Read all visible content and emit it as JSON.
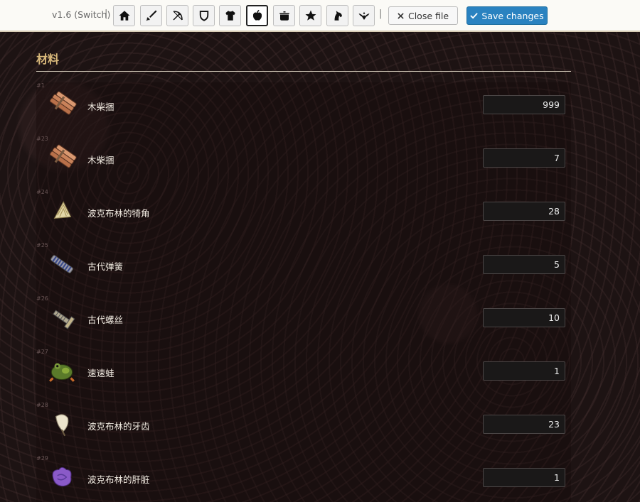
{
  "toolbar": {
    "version": "v1.6 (Switch)",
    "separator": "|",
    "category_buttons": [
      {
        "icon": "home-icon"
      },
      {
        "icon": "sword-icon"
      },
      {
        "icon": "bow-icon"
      },
      {
        "icon": "shield-icon"
      },
      {
        "icon": "armor-icon"
      },
      {
        "icon": "apple-icon",
        "active": true
      },
      {
        "icon": "cooking-pot-icon"
      },
      {
        "icon": "star-icon"
      },
      {
        "icon": "horse-icon"
      },
      {
        "icon": "hylian-crest-icon"
      }
    ],
    "close_label": "Close file",
    "save_label": "Save changes",
    "accent_color": "#2a82c0"
  },
  "section": {
    "title": "材料",
    "title_color": "#d8b87a"
  },
  "items": [
    {
      "num": "#1",
      "name": "木柴捆",
      "qty": "999",
      "icon": "wood-bundle-icon"
    },
    {
      "num": "#23",
      "name": "木柴捆",
      "qty": "7",
      "icon": "wood-bundle-icon"
    },
    {
      "num": "#24",
      "name": "波克布林的犄角",
      "qty": "28",
      "icon": "bokoblin-horn-icon"
    },
    {
      "num": "#25",
      "name": "古代弹簧",
      "qty": "5",
      "icon": "ancient-spring-icon"
    },
    {
      "num": "#26",
      "name": "古代螺丝",
      "qty": "10",
      "icon": "ancient-screw-icon"
    },
    {
      "num": "#27",
      "name": "速速蛙",
      "qty": "1",
      "icon": "hot-footed-frog-icon"
    },
    {
      "num": "#28",
      "name": "波克布林的牙齿",
      "qty": "23",
      "icon": "bokoblin-fang-icon"
    },
    {
      "num": "#29",
      "name": "波克布林的肝脏",
      "qty": "1",
      "icon": "bokoblin-guts-icon"
    }
  ]
}
